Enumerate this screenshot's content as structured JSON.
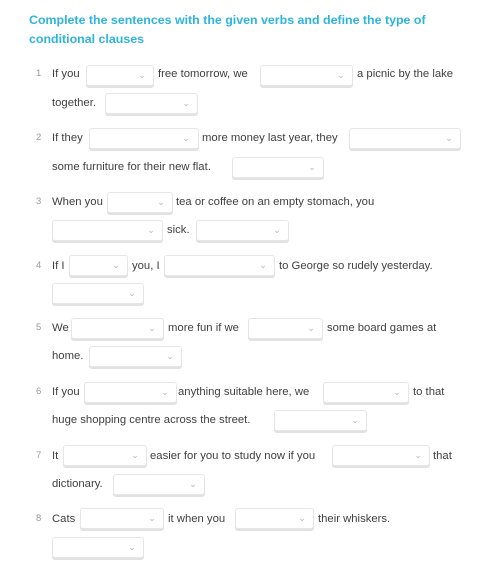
{
  "header": {
    "title": "Complete the sentences with the given verbs and define the type of conditional clauses"
  },
  "icons": {
    "dropdown": "chevron-down-icon"
  },
  "sentences": [
    {
      "number": "1",
      "parts": [
        "If you",
        "free tomorrow, we",
        "a picnic by the lake",
        "together."
      ]
    },
    {
      "number": "2",
      "parts": [
        "If they",
        "more money last year, they",
        "some furniture for their new flat."
      ]
    },
    {
      "number": "3",
      "parts": [
        "When you",
        "tea or coffee on an empty stomach, you",
        "sick."
      ]
    },
    {
      "number": "4",
      "parts": [
        "If I",
        "you, I",
        "to George so rudely yesterday."
      ]
    },
    {
      "number": "5",
      "parts": [
        "We",
        "more fun if we",
        "some board games at",
        "home."
      ]
    },
    {
      "number": "6",
      "parts": [
        "If you",
        "anything suitable here, we",
        "to that",
        "huge shopping centre across the street."
      ]
    },
    {
      "number": "7",
      "parts": [
        "It",
        "easier for you to study now if you",
        "that",
        "dictionary."
      ]
    },
    {
      "number": "8",
      "parts": [
        "Cats",
        "it when you",
        "their whiskers."
      ]
    }
  ],
  "dropdowns": {
    "selected_value": ""
  }
}
